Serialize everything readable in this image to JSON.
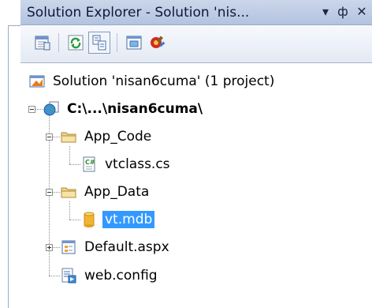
{
  "panel": {
    "title": "Solution Explorer - Solution 'nis...",
    "dropdown_glyph": "▾",
    "pin_glyph": "ф",
    "close_glyph": "✕"
  },
  "toolbar": {
    "buttons": [
      {
        "name": "properties",
        "icon": "properties-icon"
      },
      {
        "name": "refresh",
        "icon": "refresh-icon"
      },
      {
        "name": "nest-related-files",
        "icon": "nest-files-icon",
        "active": true
      },
      {
        "name": "view-designer",
        "icon": "view-designer-icon"
      },
      {
        "name": "asp-net-configuration",
        "icon": "asp-net-config-icon"
      }
    ]
  },
  "tree": {
    "solution": {
      "label": "Solution 'nisan6cuma' (1 project)"
    },
    "project": {
      "label": "C:\\...\\nisan6cuma\\"
    },
    "app_code": {
      "label": "App_Code"
    },
    "vtclass": {
      "label": "vtclass.cs"
    },
    "app_data": {
      "label": "App_Data"
    },
    "vtmdb": {
      "label": "vt.mdb"
    },
    "default_aspx": {
      "label": "Default.aspx"
    },
    "web_config": {
      "label": "web.config"
    }
  },
  "colors": {
    "selection": "#3399ff",
    "titlebar": "#c2d0e8",
    "folder": "#f0d48a"
  }
}
